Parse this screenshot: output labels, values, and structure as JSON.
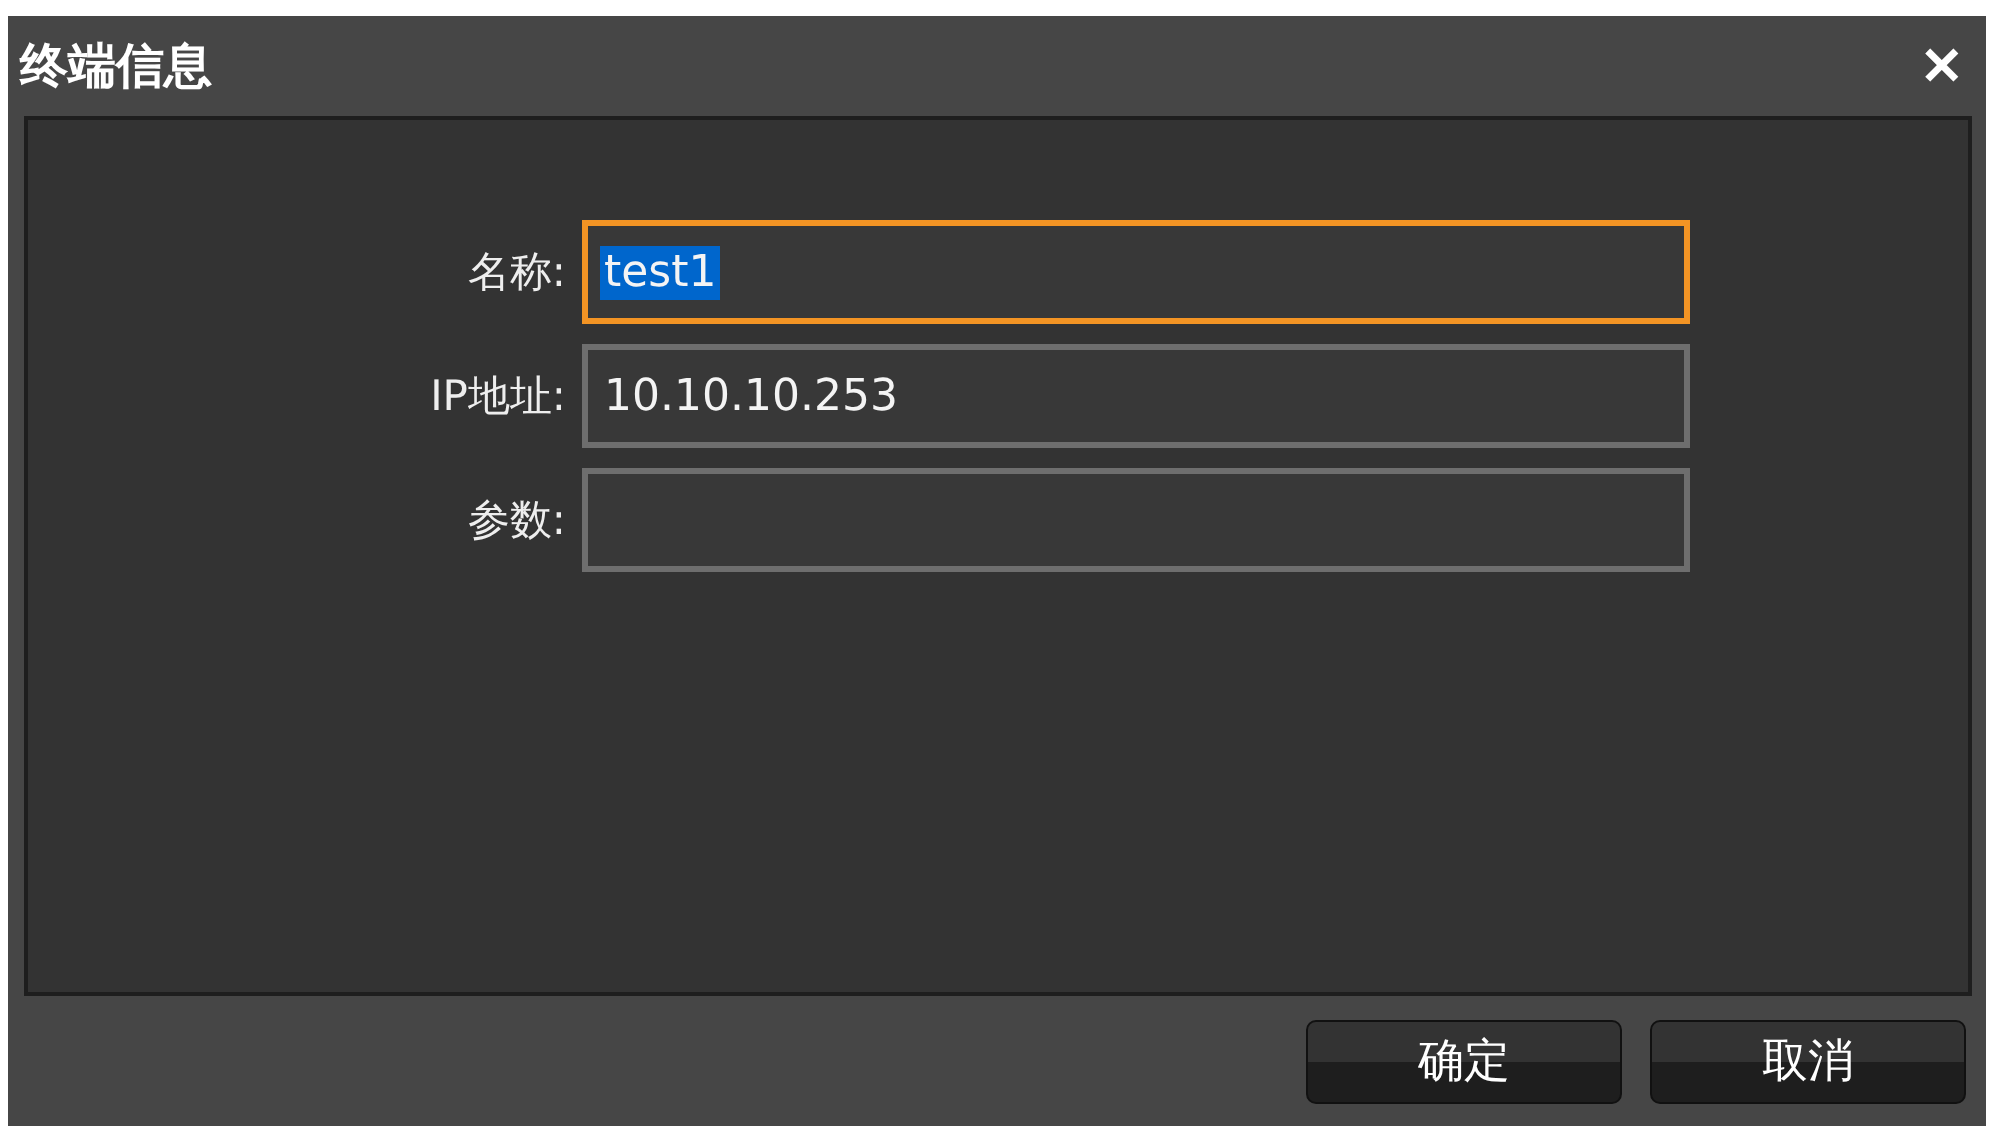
{
  "window": {
    "title": "终端信息",
    "close": "✕"
  },
  "fields": [
    {
      "label": "名称:",
      "value": "test1",
      "focused": true,
      "value_selected": true
    },
    {
      "label": "IP地址:",
      "value": "10.10.10.253",
      "focused": false,
      "value_selected": false
    },
    {
      "label": "参数:",
      "focused": false
    }
  ],
  "buttons": [
    "确定",
    "取消"
  ]
}
